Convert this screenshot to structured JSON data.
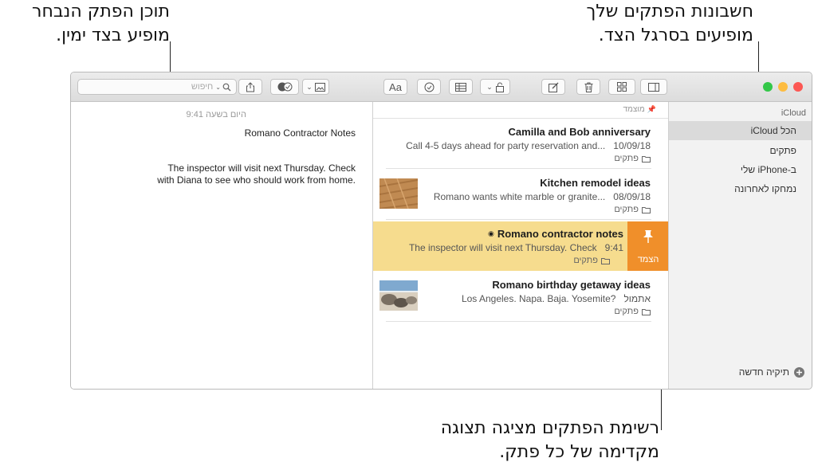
{
  "callouts": {
    "top_right": [
      "חשבונות הפתקים שלך",
      "מופיעים בסרגל הצד."
    ],
    "top_left": [
      "תוכן הפתק הנבחר",
      "מופיע בצד ימין."
    ],
    "bottom": [
      "רשימת הפתקים מציגה תצוגה",
      "מקדימה של כל פתק."
    ]
  },
  "toolbar": {
    "search_placeholder": "חיפוש",
    "font_label": "Aa"
  },
  "sidebar": {
    "account": "iCloud",
    "items": [
      {
        "label": "הכל iCloud",
        "selected": true
      },
      {
        "label": "פתקים",
        "selected": false
      },
      {
        "label": "ב-iPhone שלי",
        "selected": false
      },
      {
        "label": "נמחקו לאחרונה",
        "selected": false
      }
    ],
    "new_folder": "תיקיה חדשה"
  },
  "list": {
    "pinned_header": "מוצמד",
    "notes": [
      {
        "title": "Camilla and Bob anniversary",
        "date": "10/09/18",
        "preview": "Call 4-5 days ahead for party reservation and...",
        "folder": "פתקים"
      },
      {
        "title": "Kitchen remodel ideas",
        "date": "08/09/18",
        "preview": "Romano wants white marble or granite...",
        "folder": "פתקים"
      },
      {
        "title": "Romano contractor notes",
        "date": "9:41",
        "preview": "The inspector will visit next Thursday. Check",
        "folder": "פתקים",
        "selected": true
      },
      {
        "title": "Romano birthday getaway ideas",
        "date": "אתמול",
        "preview": "Los Angeles. Napa. Baja. Yosemite?",
        "folder": "פתקים"
      }
    ],
    "pin_action": "הצמד"
  },
  "detail": {
    "timestamp": "היום בשעה 9:41",
    "title": "Romano Contractor Notes",
    "body": "The inspector will visit next Thursday. Check with Diana to see who should work from home."
  },
  "colors": {
    "selected_note": "#f6dc8e",
    "pin_orange": "#f08f2a",
    "sidebar_selected": "#dadada",
    "traffic_close": "#fc5753",
    "traffic_min": "#fdbc40",
    "traffic_max": "#33c748"
  }
}
